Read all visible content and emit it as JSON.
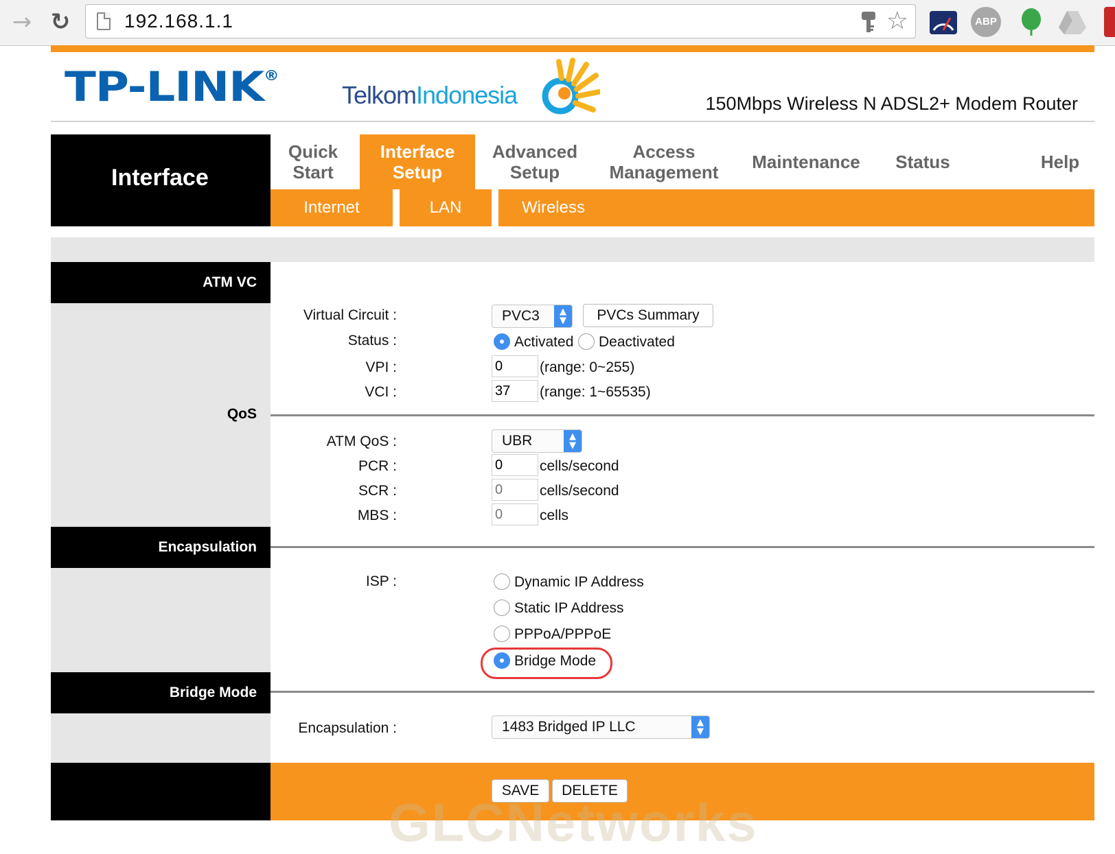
{
  "browser": {
    "url": "192.168.1.1",
    "extensions": [
      "speedtest-icon",
      "adblock-plus-icon",
      "evernote-icon",
      "google-drive-icon"
    ],
    "abp_label": "ABP"
  },
  "brand": {
    "tplink": "TP-LINK",
    "registered": "®",
    "telkom_part1": "Telkom",
    "telkom_part2": "Indonesia",
    "model": "150Mbps Wireless N ADSL2+ Modem Router"
  },
  "nav": {
    "section_title": "Interface",
    "tabs": [
      {
        "label": "Quick\nStart"
      },
      {
        "label": "Interface\nSetup",
        "active": true
      },
      {
        "label": "Advanced\nSetup"
      },
      {
        "label": "Access\nManagement"
      },
      {
        "label": "Maintenance"
      },
      {
        "label": "Status"
      },
      {
        "label": "Help"
      }
    ],
    "subtabs": [
      {
        "label": "Internet"
      },
      {
        "label": "LAN"
      },
      {
        "label": "Wireless"
      }
    ]
  },
  "sections": {
    "atm_vc": "ATM VC",
    "qos": "QoS",
    "encapsulation": "Encapsulation",
    "bridge_mode": "Bridge Mode"
  },
  "atm_vc": {
    "virtual_circuit_label": "Virtual Circuit :",
    "virtual_circuit_value": "PVC3",
    "pvcs_summary_button": "PVCs Summary",
    "status_label": "Status :",
    "status_options": [
      "Activated",
      "Deactivated"
    ],
    "status_selected": "Activated",
    "vpi_label": "VPI :",
    "vpi_value": "0",
    "vpi_range": "(range: 0~255)",
    "vci_label": "VCI :",
    "vci_value": "37",
    "vci_range": "(range: 1~65535)"
  },
  "qos": {
    "atm_qos_label": "ATM QoS :",
    "atm_qos_value": "UBR",
    "pcr_label": "PCR :",
    "pcr_value": "0",
    "pcr_unit": "cells/second",
    "scr_label": "SCR :",
    "scr_value": "0",
    "scr_unit": "cells/second",
    "mbs_label": "MBS :",
    "mbs_value": "0",
    "mbs_unit": "cells"
  },
  "encapsulation": {
    "isp_label": "ISP :",
    "options": [
      "Dynamic IP Address",
      "Static IP Address",
      "PPPoA/PPPoE",
      "Bridge Mode"
    ],
    "selected": "Bridge Mode"
  },
  "bridge": {
    "encapsulation_label": "Encapsulation :",
    "encapsulation_value": "1483 Bridged IP LLC"
  },
  "actions": {
    "save": "SAVE",
    "delete": "DELETE"
  },
  "watermark": "GLCNetworks",
  "colors": {
    "accent": "#f7941d",
    "tplink_blue": "#0a63b0",
    "radio_blue": "#3f8ff0",
    "highlight": "#e8373a"
  }
}
